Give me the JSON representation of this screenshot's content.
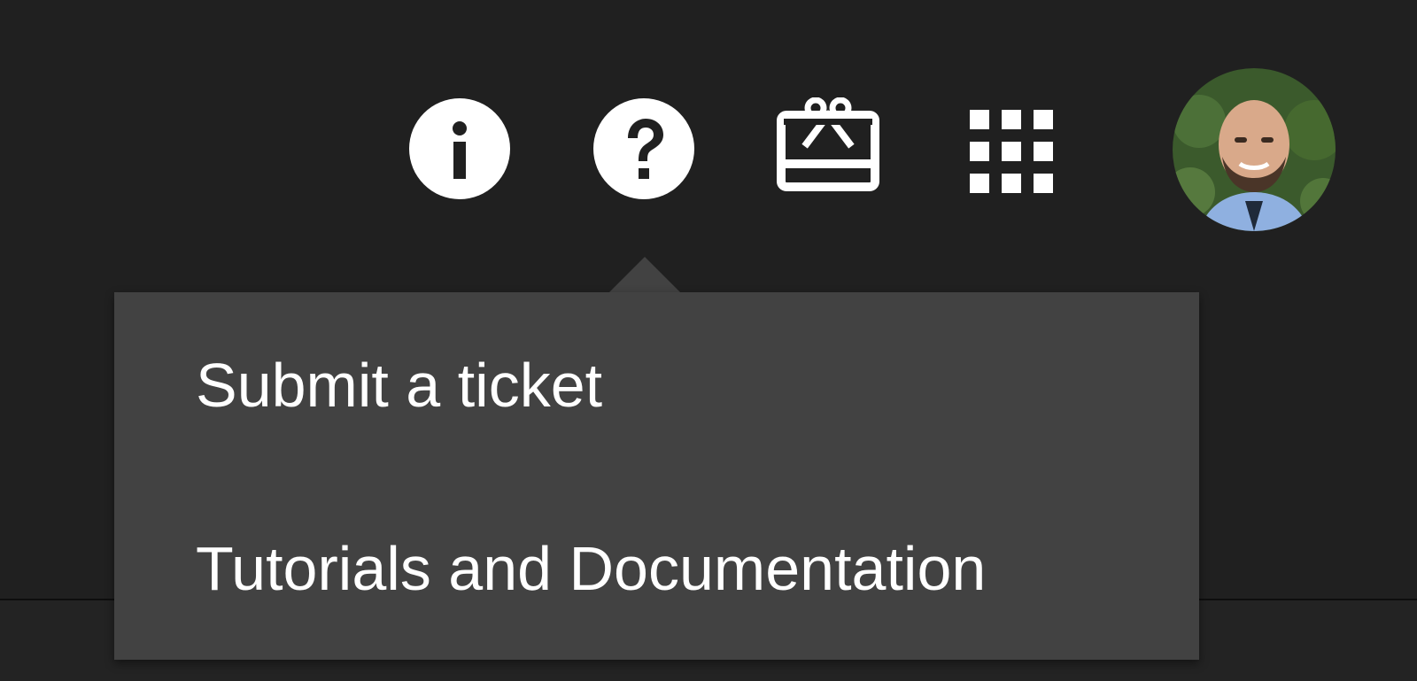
{
  "header": {
    "icons": [
      {
        "name": "info-icon"
      },
      {
        "name": "help-icon"
      },
      {
        "name": "gift-card-icon"
      },
      {
        "name": "apps-grid-icon"
      }
    ],
    "avatar": {
      "name": "avatar"
    }
  },
  "help_menu": {
    "items": [
      {
        "label": "Submit a ticket"
      },
      {
        "label": "Tutorials and Documentation"
      }
    ]
  },
  "colors": {
    "background": "#202020",
    "menu": "#424242",
    "icon": "#ffffff"
  }
}
